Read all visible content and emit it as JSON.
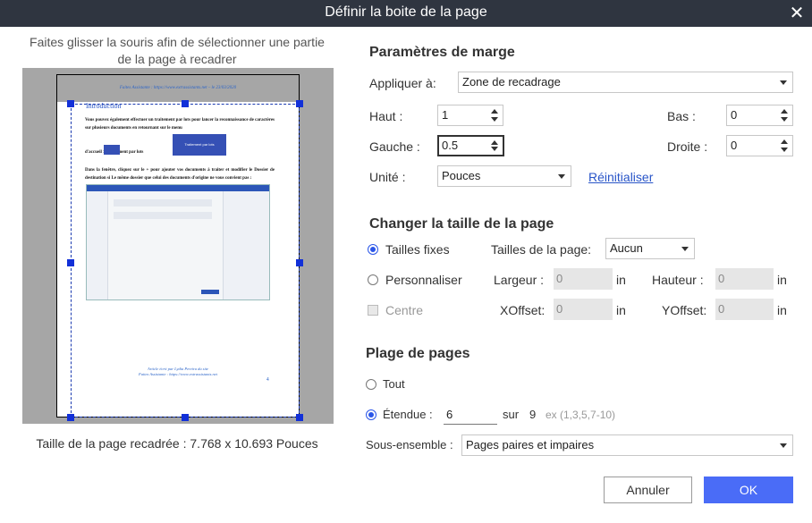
{
  "window": {
    "title": "Définir la boite de la page",
    "close_icon": "close-icon"
  },
  "preview": {
    "instruction": "Faites glisser la souris afin de sélectionner une partie de la page à recadrer",
    "crop_size_label": "Taille de la page recadrée : 7.768 x 10.693 Pouces",
    "doc": {
      "header": "Faites Assistante : https://www.extrassistants.net – le 23/03/2020",
      "heading": "Introduction",
      "para1": "Vous pouvez également effectuer un traitement par lots pour lancer la reconnaissance de caractères sur plusieurs documents en retournant sur le menu",
      "para1b": "d'accueil       > Traitement par lots",
      "inline_button": "Traitement par lots",
      "para2": "Dans la fenêtre, cliquez sur le + pour ajouter vos documents à traiter et modifier le Dossier de destination si Le même dossier que celui des documents d'origine ne vous convient pas :",
      "screenshot_title": "Traitement par lots",
      "footer1": "Article écrit par Lydia Pereira du site",
      "footer2": "Faites Assistante : https://www.extrassistants.net",
      "page_number": "4"
    }
  },
  "margins": {
    "section_title": "Paramètres de marge",
    "apply_label": "Appliquer à:",
    "apply_value": "Zone de recadrage",
    "top_label": "Haut :",
    "top_value": "1",
    "bottom_label": "Bas :",
    "bottom_value": "0",
    "left_label": "Gauche :",
    "left_value": "0.5",
    "right_label": "Droite :",
    "right_value": "0",
    "unit_label": "Unité :",
    "unit_value": "Pouces",
    "reset_link": "Réinitialiser"
  },
  "page_size": {
    "section_title": "Changer la taille de la page",
    "fixed_label": "Tailles fixes",
    "fixed_checked": true,
    "size_label": "Tailles de la page:",
    "size_value": "Aucun",
    "custom_label": "Personnaliser",
    "width_label": "Largeur :",
    "width_value": "0",
    "width_unit": "in",
    "height_label": "Hauteur :",
    "height_value": "0",
    "height_unit": "in",
    "center_label": "Centre",
    "xoffset_label": "XOffset:",
    "xoffset_value": "0",
    "xoffset_unit": "in",
    "yoffset_label": "YOffset:",
    "yoffset_value": "0",
    "yoffset_unit": "in"
  },
  "page_range": {
    "section_title": "Plage de pages",
    "all_label": "Tout",
    "range_label": "Étendue :",
    "range_checked": true,
    "range_value": "6",
    "of_label": "sur",
    "total_pages": "9",
    "range_hint": "ex (1,3,5,7-10)",
    "subset_label": "Sous-ensemble :",
    "subset_value": "Pages paires et impaires"
  },
  "buttons": {
    "cancel": "Annuler",
    "ok": "OK"
  },
  "colors": {
    "titlebar": "#2f3540",
    "accent": "#4a6cf7",
    "link": "#2955c8",
    "crop_handle": "#1230d8"
  }
}
